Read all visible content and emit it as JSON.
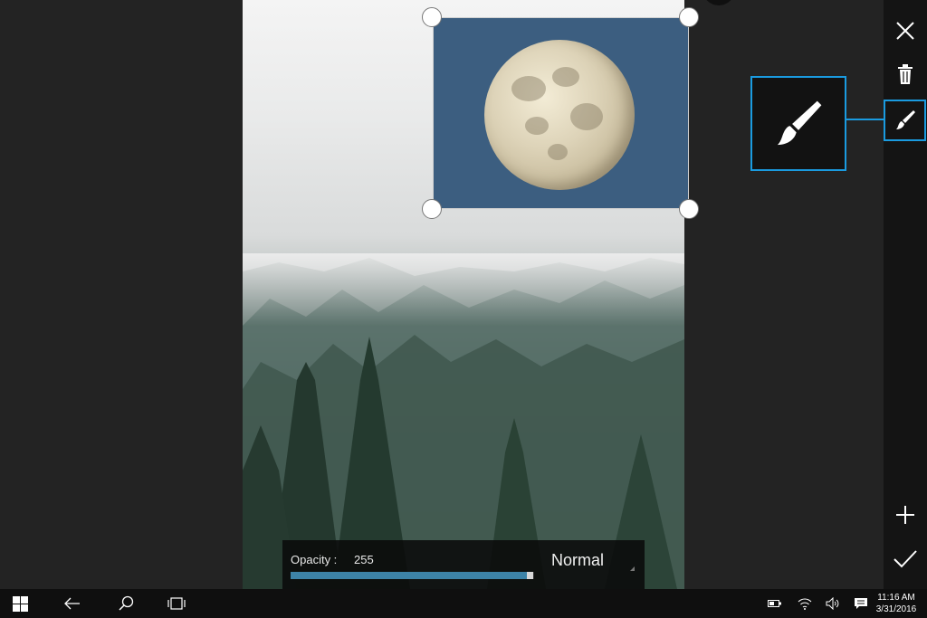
{
  "sticker_panel": {
    "opacity_label": "Opacity :",
    "opacity_value": "255",
    "opacity_fraction": 0.996,
    "blend_mode": "Normal"
  },
  "toolbar": {
    "close_icon": "close-icon",
    "delete_icon": "trash-icon",
    "brush_icon": "brush-icon",
    "add_icon": "plus-icon",
    "confirm_icon": "check-icon"
  },
  "taskbar": {
    "time": "11:16 AM",
    "date": "3/31/2016",
    "icons": [
      "windows-start-icon",
      "back-icon",
      "search-icon",
      "task-view-icon",
      "battery-icon",
      "wifi-icon",
      "volume-icon",
      "action-center-icon"
    ]
  },
  "colors": {
    "accent": "#1a9be0",
    "slider_fill": "#3d83a7",
    "sticker_background": "#3c5e80"
  }
}
